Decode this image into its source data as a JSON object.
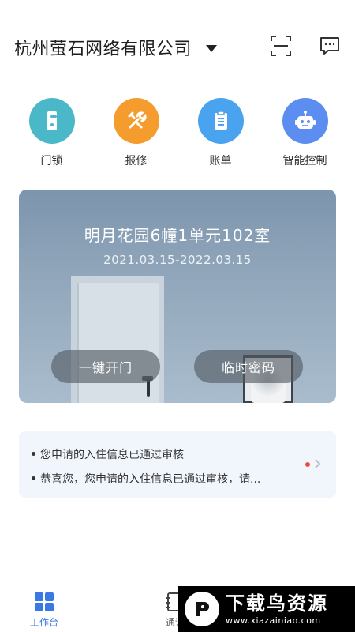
{
  "header": {
    "company_name": "杭州萤石网络有限公司",
    "scan_icon": "scan-icon",
    "message_icon": "message-icon"
  },
  "actions": [
    {
      "label": "门锁",
      "icon": "door-lock-icon",
      "color": "#4bb8c9"
    },
    {
      "label": "报修",
      "icon": "repair-tools-icon",
      "color": "#f59c2f"
    },
    {
      "label": "账单",
      "icon": "bill-clipboard-icon",
      "color": "#4aa3ee"
    },
    {
      "label": "智能控制",
      "icon": "robot-icon",
      "color": "#5b8ef0"
    }
  ],
  "house_card": {
    "title": "明月花园6幢1单元102室",
    "date_range": "2021.03.15-2022.03.15",
    "open_button": "一键开门",
    "temp_password_button": "临时密码"
  },
  "notices": {
    "items": [
      "您申请的入住信息已通过审核",
      "恭喜您，您申请的入住信息已通过审核，请..."
    ],
    "has_unread": true,
    "unread_color": "#ee4b3f"
  },
  "tabbar": {
    "tabs": [
      {
        "label": "工作台",
        "active": true,
        "icon": "grid-icon"
      },
      {
        "label": "通讯",
        "active": false,
        "icon": "contacts-icon"
      }
    ],
    "active_color": "#3a78e6"
  },
  "watermark": {
    "title": "下载鸟资源",
    "url": "www.xiazainiao.com"
  }
}
